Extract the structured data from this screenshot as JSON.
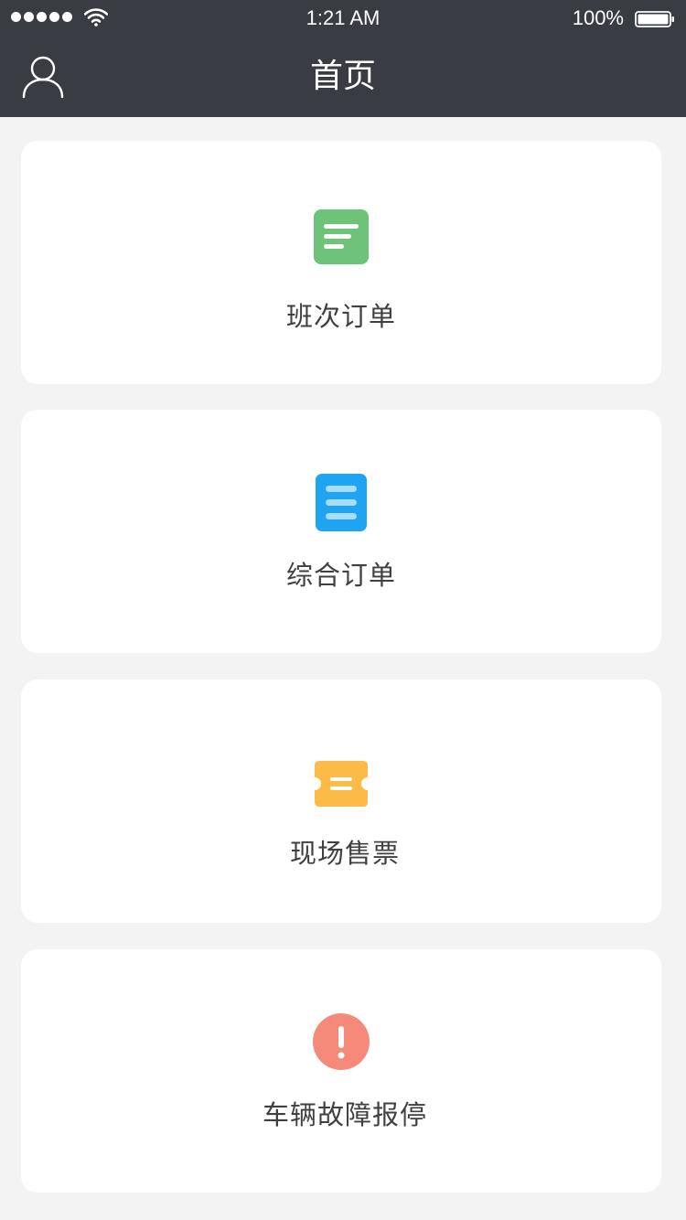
{
  "status_bar": {
    "time": "1:21 AM",
    "battery": "100%"
  },
  "header": {
    "title": "首页",
    "user_icon": "user-icon"
  },
  "menu": {
    "items": [
      {
        "label": "班次订单",
        "icon": "shift-order-icon",
        "color": "#6dc478"
      },
      {
        "label": "综合订单",
        "icon": "comprehensive-order-icon",
        "color": "#1fa4f2"
      },
      {
        "label": "现场售票",
        "icon": "ticket-icon",
        "color": "#fcbb47"
      },
      {
        "label": "车辆故障报停",
        "icon": "fault-alert-icon",
        "color": "#f58a7a"
      }
    ]
  },
  "colors": {
    "header_bg": "#393c43",
    "page_bg": "#f3f3f3",
    "card_bg": "#ffffff"
  }
}
